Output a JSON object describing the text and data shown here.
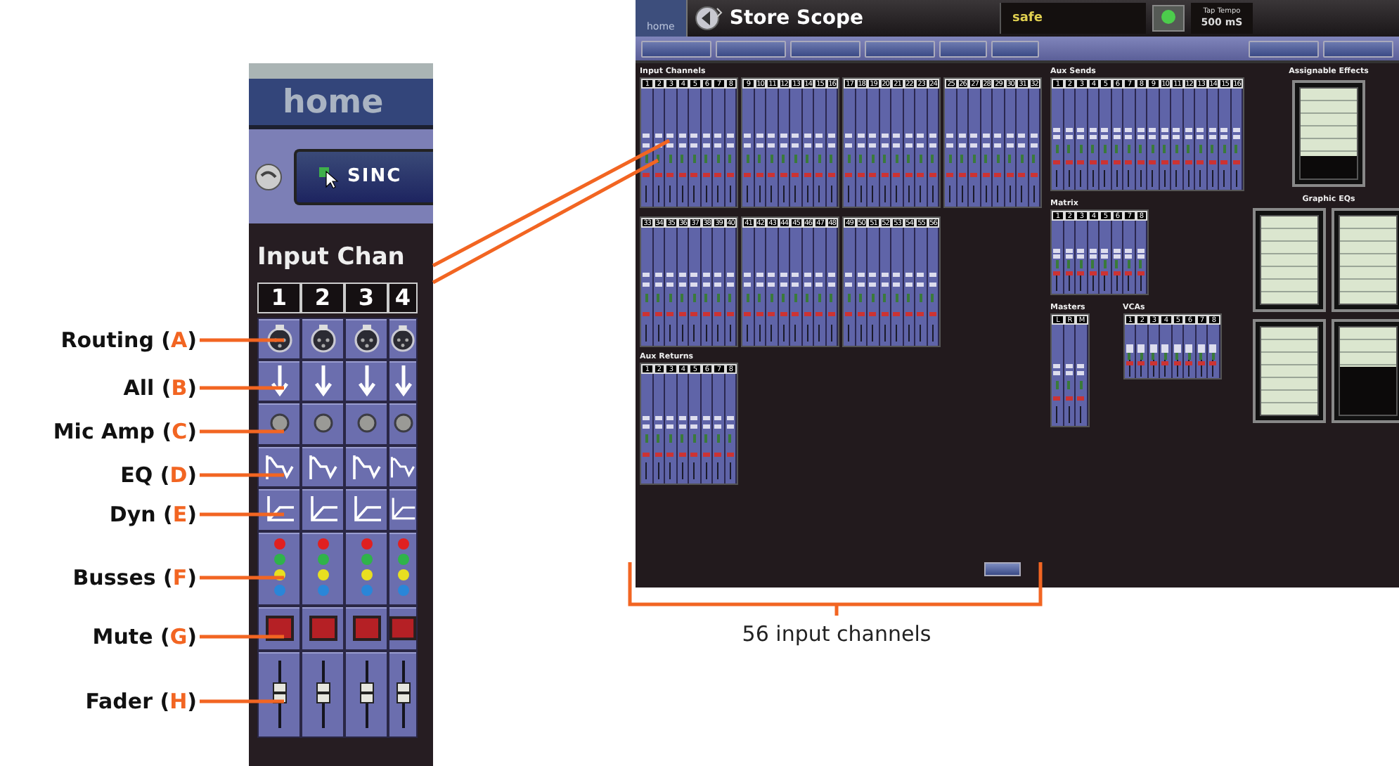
{
  "callouts": [
    {
      "before": "Routing (",
      "letter": "A",
      "after": ")",
      "kind": "routing"
    },
    {
      "before": "All (",
      "letter": "B",
      "after": ")",
      "kind": "all"
    },
    {
      "before": "Mic Amp (",
      "letter": "C",
      "after": ")",
      "kind": "mic_amp"
    },
    {
      "before": "EQ (",
      "letter": "D",
      "after": ")",
      "kind": "eq"
    },
    {
      "before": "Dyn (",
      "letter": "E",
      "after": ")",
      "kind": "dyn"
    },
    {
      "before": "Busses (",
      "letter": "F",
      "after": ")",
      "kind": "busses"
    },
    {
      "before": "Mute (",
      "letter": "G",
      "after": ")",
      "kind": "mute"
    },
    {
      "before": "Fader (",
      "letter": "H",
      "after": ")",
      "kind": "fader"
    }
  ],
  "zoom": {
    "home": "home",
    "button": "SINC",
    "section": "Input Chan",
    "channels": [
      "1",
      "2",
      "3",
      "4"
    ]
  },
  "screen": {
    "home": "home",
    "title": "Store Scope",
    "status": "safe",
    "tap_tempo_label": "Tap Tempo",
    "tap_tempo_value": "500 mS",
    "input_channels": {
      "title": "Input Channels",
      "groups": [
        [
          "1",
          "2",
          "3",
          "4",
          "5",
          "6",
          "7",
          "8"
        ],
        [
          "9",
          "10",
          "11",
          "12",
          "13",
          "14",
          "15",
          "16"
        ],
        [
          "17",
          "18",
          "19",
          "20",
          "21",
          "22",
          "23",
          "24"
        ],
        [
          "25",
          "26",
          "27",
          "28",
          "29",
          "30",
          "31",
          "32"
        ],
        [
          "33",
          "34",
          "35",
          "36",
          "37",
          "38",
          "39",
          "40"
        ],
        [
          "41",
          "42",
          "43",
          "44",
          "45",
          "46",
          "47",
          "48"
        ],
        [
          "49",
          "50",
          "51",
          "52",
          "53",
          "54",
          "55",
          "56"
        ]
      ]
    },
    "aux_returns": {
      "title": "Aux Returns",
      "channels": [
        "1",
        "2",
        "3",
        "4",
        "5",
        "6",
        "7",
        "8"
      ]
    },
    "aux_sends": {
      "title": "Aux Sends",
      "channels": [
        "1",
        "2",
        "3",
        "4",
        "5",
        "6",
        "7",
        "8",
        "9",
        "10",
        "11",
        "12",
        "13",
        "14",
        "15",
        "16"
      ]
    },
    "matrix": {
      "title": "Matrix",
      "channels": [
        "1",
        "2",
        "3",
        "4",
        "5",
        "6",
        "7",
        "8"
      ]
    },
    "masters": {
      "title": "Masters",
      "channels": [
        "L",
        "R",
        "M"
      ]
    },
    "vcas": {
      "title": "VCAs",
      "channels": [
        "1",
        "2",
        "3",
        "4",
        "5",
        "6",
        "7",
        "8"
      ]
    },
    "assignable_effects": {
      "title": "Assignable Effects",
      "level": 0.75
    },
    "graphic_eqs": {
      "title": "Graphic EQs",
      "units": [
        {
          "level": 1
        },
        {
          "level": 1
        },
        {
          "level": 1
        },
        {
          "level": 0.45
        }
      ]
    }
  },
  "caption": "56 input channels"
}
